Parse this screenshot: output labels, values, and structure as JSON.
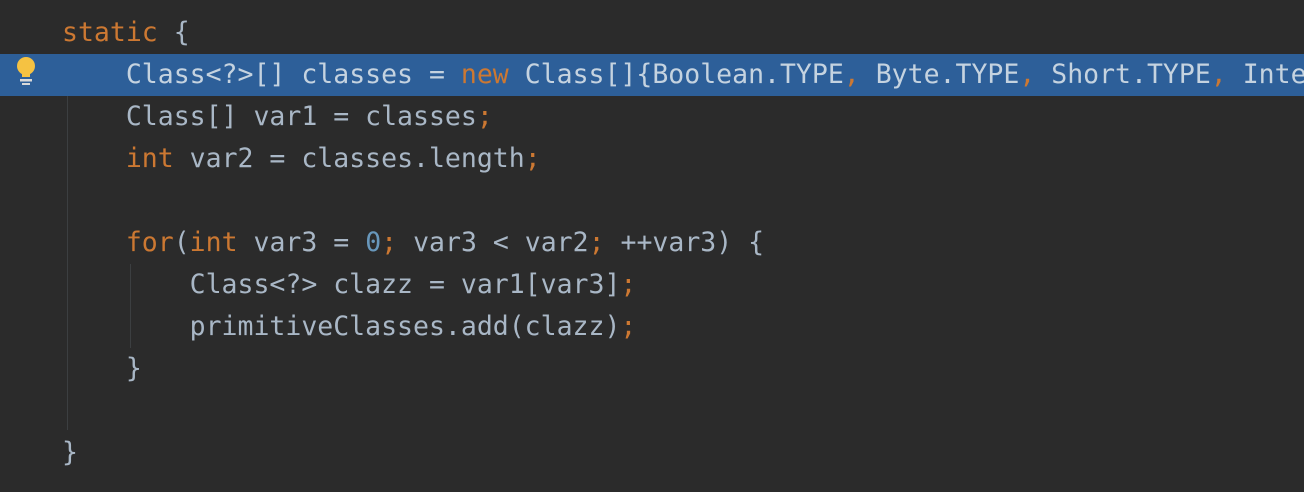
{
  "editor": {
    "language": "Java",
    "colors": {
      "background": "#2b2b2b",
      "current_line": "#2d5f99",
      "keyword": "#cc7832",
      "number": "#6897bb",
      "text": "#a9b7c6"
    },
    "gutter_icon": "intention-bulb-icon",
    "lines": [
      {
        "indent": "",
        "tokens": [
          {
            "t": "static",
            "c": "kw"
          },
          {
            "t": " {",
            "c": "plain"
          }
        ]
      },
      {
        "indent": "    ",
        "current": true,
        "tokens": [
          {
            "t": "Class<?>[] classes = ",
            "c": "plain"
          },
          {
            "t": "new",
            "c": "kw"
          },
          {
            "t": " Class[]{Boolean.TYPE",
            "c": "plain"
          },
          {
            "t": ",",
            "c": "punct"
          },
          {
            "t": " Byte.TYPE",
            "c": "plain"
          },
          {
            "t": ",",
            "c": "punct"
          },
          {
            "t": " Short.TYPE",
            "c": "plain"
          },
          {
            "t": ",",
            "c": "punct"
          },
          {
            "t": " Inte",
            "c": "plain"
          }
        ]
      },
      {
        "indent": "    ",
        "tokens": [
          {
            "t": "Class[] var1 = classes",
            "c": "plain"
          },
          {
            "t": ";",
            "c": "punct"
          }
        ]
      },
      {
        "indent": "    ",
        "tokens": [
          {
            "t": "int",
            "c": "kw"
          },
          {
            "t": " var2 = classes.length",
            "c": "plain"
          },
          {
            "t": ";",
            "c": "punct"
          }
        ]
      },
      {
        "indent": "",
        "tokens": []
      },
      {
        "indent": "    ",
        "tokens": [
          {
            "t": "for",
            "c": "kw"
          },
          {
            "t": "(",
            "c": "plain"
          },
          {
            "t": "int",
            "c": "kw"
          },
          {
            "t": " var3 = ",
            "c": "plain"
          },
          {
            "t": "0",
            "c": "num"
          },
          {
            "t": ";",
            "c": "punct"
          },
          {
            "t": " var3 < var2",
            "c": "plain"
          },
          {
            "t": ";",
            "c": "punct"
          },
          {
            "t": " ++var3) {",
            "c": "plain"
          }
        ]
      },
      {
        "indent": "        ",
        "tokens": [
          {
            "t": "Class<?> clazz = var1[var3]",
            "c": "plain"
          },
          {
            "t": ";",
            "c": "punct"
          }
        ]
      },
      {
        "indent": "        ",
        "tokens": [
          {
            "t": "primitiveClasses.add(clazz)",
            "c": "plain"
          },
          {
            "t": ";",
            "c": "punct"
          }
        ]
      },
      {
        "indent": "    ",
        "tokens": [
          {
            "t": "}",
            "c": "plain"
          }
        ]
      },
      {
        "indent": "",
        "tokens": []
      },
      {
        "indent": "",
        "tokens": [
          {
            "t": "}",
            "c": "plain"
          }
        ]
      }
    ]
  }
}
